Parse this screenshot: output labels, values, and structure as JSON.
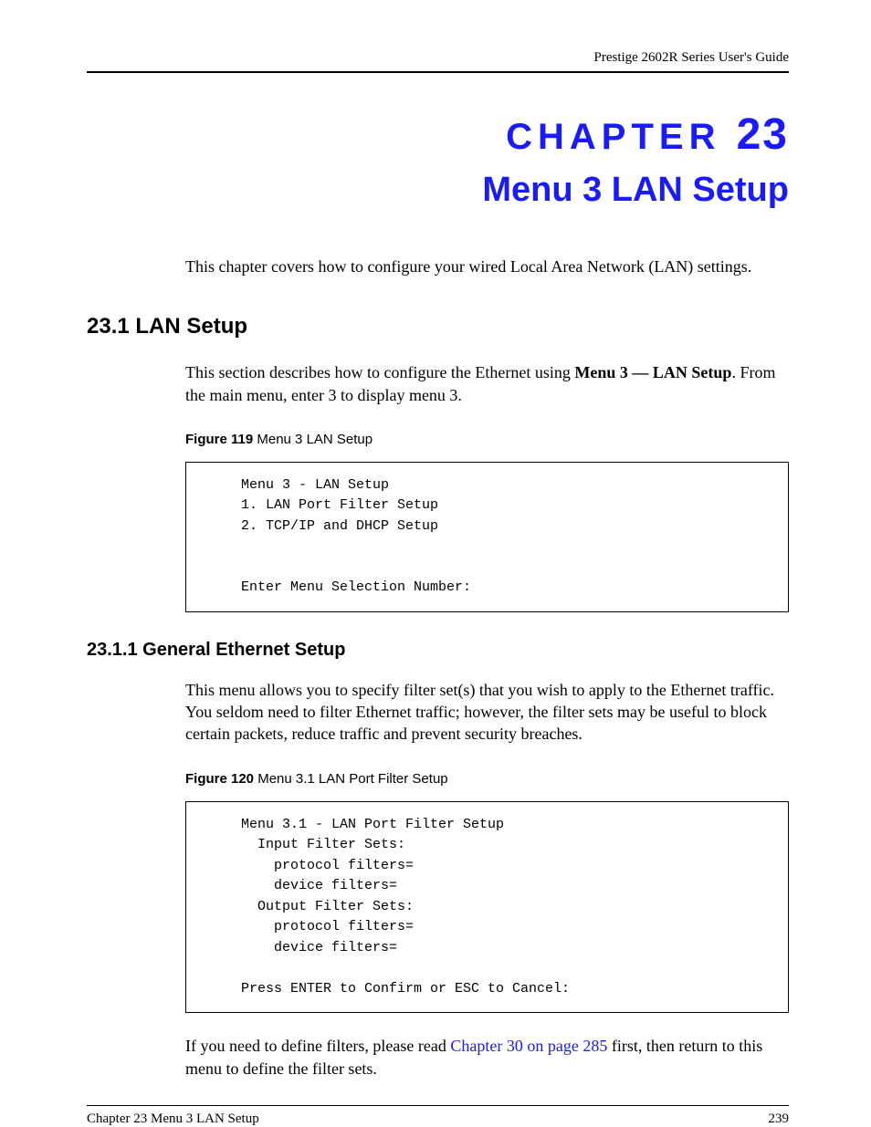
{
  "header": {
    "guide_title": "Prestige 2602R Series User's Guide"
  },
  "chapter": {
    "label_word": "CHAPTER",
    "label_num": "23",
    "title": "Menu 3 LAN Setup",
    "intro": "This chapter covers how to configure your wired Local Area Network (LAN) settings."
  },
  "section_23_1": {
    "heading": "23.1  LAN Setup",
    "body_pre": "This section describes how to configure the Ethernet using ",
    "body_bold": "Menu 3 — LAN Setup",
    "body_post": ". From the main menu, enter 3 to display menu 3."
  },
  "figure_119": {
    "label": "Figure 119",
    "caption": "   Menu 3 LAN Setup",
    "terminal": "Menu 3 - LAN Setup\n1. LAN Port Filter Setup\n2. TCP/IP and DHCP Setup\n\n\nEnter Menu Selection Number:"
  },
  "section_23_1_1": {
    "heading": "23.1.1  General Ethernet Setup",
    "body": "This menu allows you to specify filter set(s) that you wish to apply to the Ethernet traffic.  You seldom need to filter Ethernet traffic; however, the filter sets may be useful to block certain packets, reduce traffic and prevent security breaches."
  },
  "figure_120": {
    "label": "Figure 120",
    "caption": "   Menu 3.1 LAN Port Filter Setup",
    "terminal": "Menu 3.1 - LAN Port Filter Setup\n  Input Filter Sets:\n    protocol filters=\n    device filters=\n  Output Filter Sets:\n    protocol filters=\n    device filters=\n\nPress ENTER to Confirm or ESC to Cancel:"
  },
  "closing": {
    "pre": "If you need to define filters, please read ",
    "link": "Chapter 30 on page 285",
    "post": " first, then return to this menu to define the filter sets."
  },
  "footer": {
    "left": "Chapter 23 Menu 3 LAN Setup",
    "right": "239"
  }
}
